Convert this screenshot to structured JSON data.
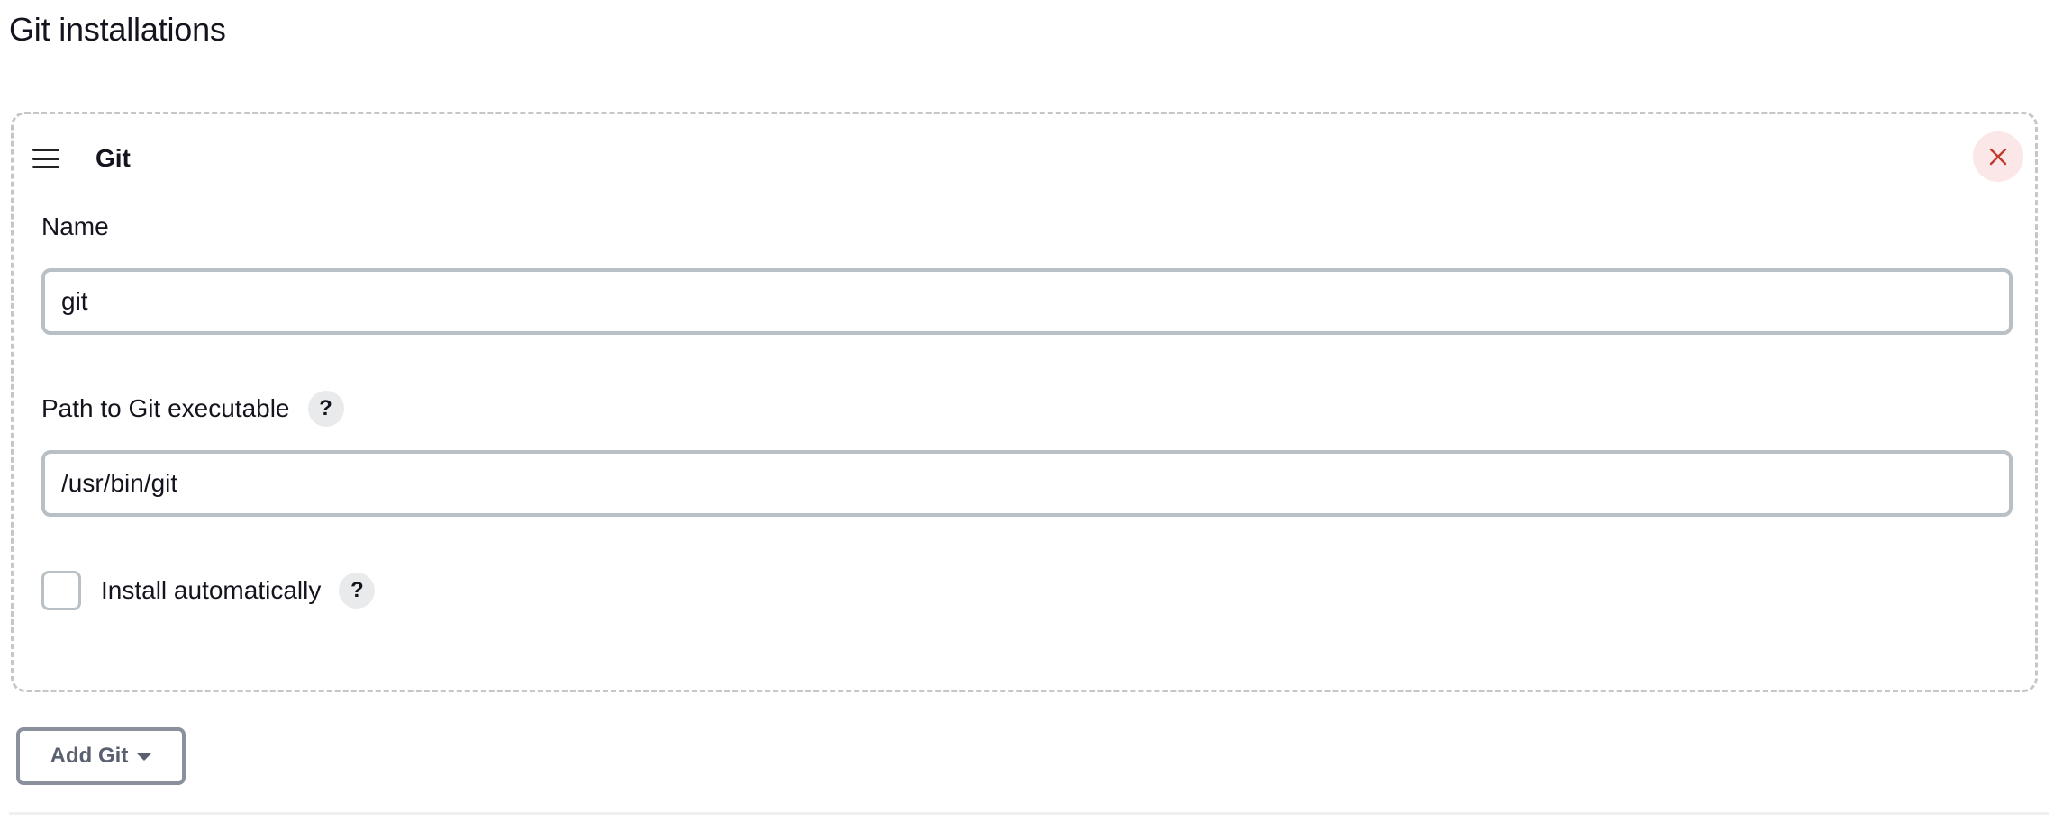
{
  "section": {
    "title": "Git installations"
  },
  "tool": {
    "title": "Git",
    "name_field": {
      "label": "Name",
      "value": "git"
    },
    "path_field": {
      "label": "Path to Git executable",
      "value": "/usr/bin/git",
      "help": "?"
    },
    "install_auto": {
      "label": "Install automatically",
      "checked": false,
      "help": "?"
    }
  },
  "actions": {
    "add_label": "Add Git"
  },
  "icons": {
    "drag": "hamburger-drag-icon",
    "close": "close-x-icon",
    "dropdown": "caret-down-icon"
  },
  "colors": {
    "close_icon": "#c0392b",
    "close_bg": "#fbe7e7",
    "input_border": "#b9c0c5",
    "card_border": "#c4c7ca"
  }
}
